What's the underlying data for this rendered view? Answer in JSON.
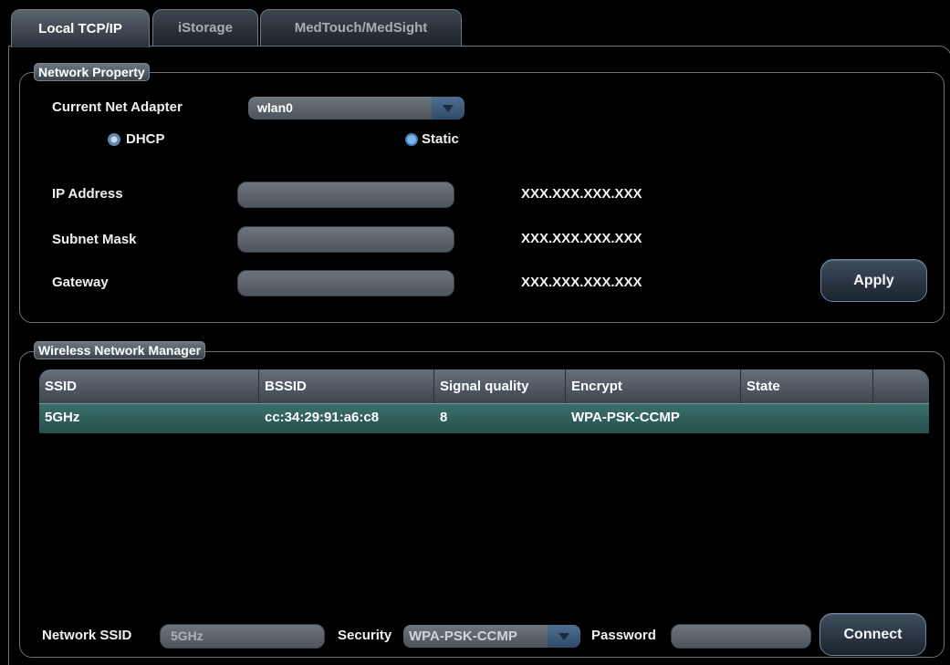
{
  "tabs": [
    {
      "label": "Local TCP/IP",
      "active": true
    },
    {
      "label": "iStorage",
      "active": false
    },
    {
      "label": "MedTouch/MedSight",
      "active": false
    }
  ],
  "network_property": {
    "legend": "Network Property",
    "adapter_label": "Current Net Adapter",
    "adapter_value": "wlan0",
    "dhcp_label": "DHCP",
    "static_label": "Static",
    "selected_mode": "Static",
    "ip_label": "IP Address",
    "ip_value": "",
    "ip_hint": "XXX.XXX.XXX.XXX",
    "subnet_label": "Subnet Mask",
    "subnet_value": "",
    "subnet_hint": "XXX.XXX.XXX.XXX",
    "gateway_label": "Gateway",
    "gateway_value": "",
    "gateway_hint": "XXX.XXX.XXX.XXX",
    "apply_label": "Apply"
  },
  "wireless": {
    "legend": "Wireless Network Manager",
    "columns": [
      "SSID",
      "BSSID",
      "Signal quality",
      "Encrypt",
      "State",
      ""
    ],
    "rows": [
      {
        "ssid": "5GHz",
        "bssid": "cc:34:29:91:a6:c8",
        "signal": "8",
        "encrypt": "WPA-PSK-CCMP",
        "state": ""
      }
    ],
    "ssid_label": "Network SSID",
    "ssid_value": "5GHz",
    "security_label": "Security",
    "security_value": "WPA-PSK-CCMP",
    "password_label": "Password",
    "password_value": "",
    "connect_label": "Connect"
  },
  "colors": {
    "selected_row": "#2f5f5a",
    "radio_static": "#4b86c4",
    "radio_dhcp": "#7fa2c6",
    "button_border": "#6c87a4"
  }
}
